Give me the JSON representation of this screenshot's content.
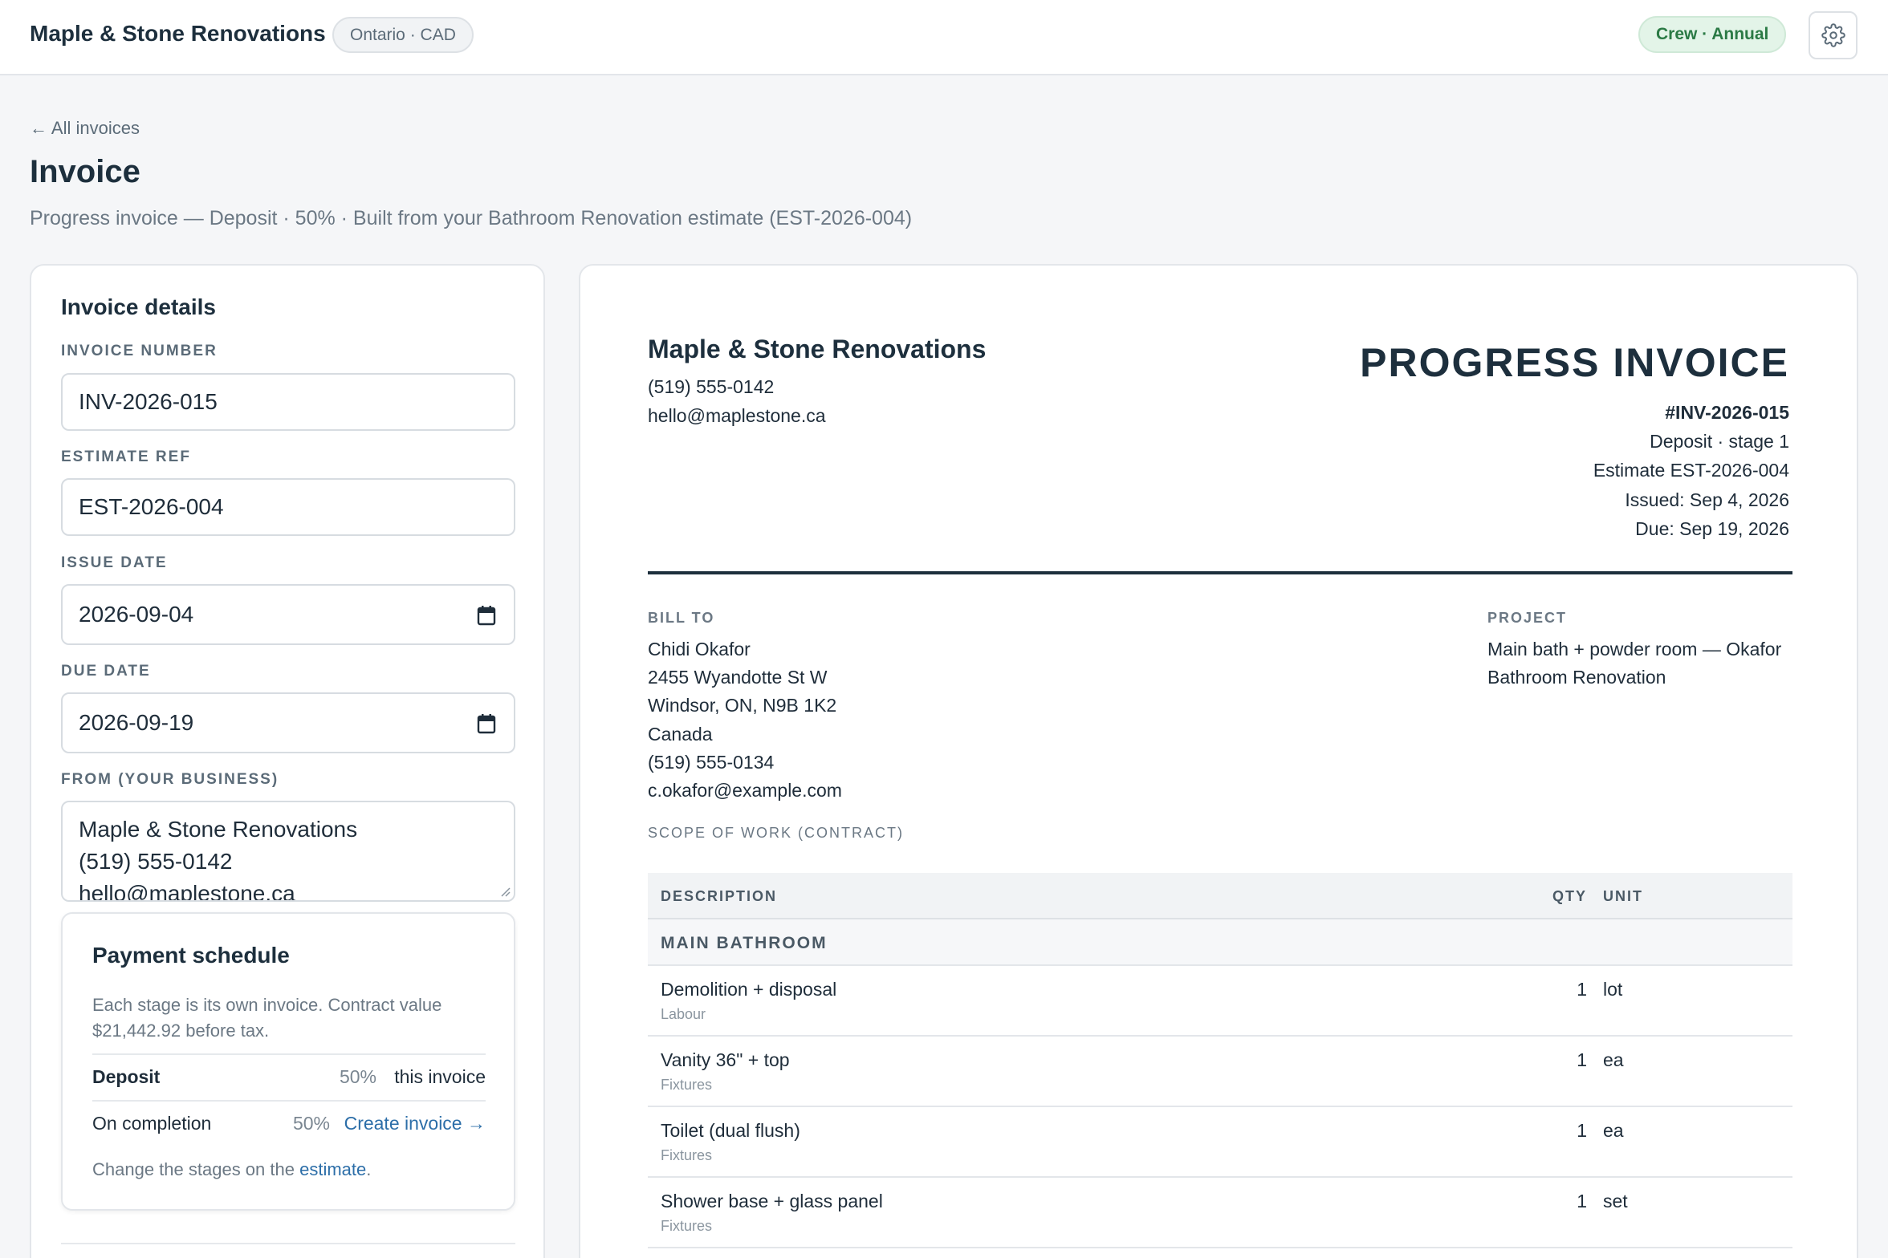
{
  "topbar": {
    "brand": "Maple & Stone Renovations",
    "region": "Ontario · CAD",
    "plan": "Crew · Annual",
    "settings_icon": "gear-icon"
  },
  "header": {
    "back_link": "← All invoices",
    "title": "Invoice",
    "subtitle": "Progress invoice — Deposit · 50% · Built from your Bathroom Renovation estimate (EST-2026-004)"
  },
  "details": {
    "title": "Invoice details",
    "invoice_number_label": "INVOICE NUMBER",
    "invoice_number": "INV-2026-015",
    "estimate_ref_label": "ESTIMATE REF",
    "estimate_ref": "EST-2026-004",
    "issue_date_label": "ISSUE DATE",
    "issue_date": "2026-09-04",
    "due_date_label": "DUE DATE",
    "due_date": "2026-09-19",
    "from_label": "FROM (YOUR BUSINESS)",
    "from_lines": [
      "Maple & Stone Renovations",
      "(519) 555-0142",
      "hello@maplestone.ca"
    ]
  },
  "payment_schedule": {
    "title": "Payment schedule",
    "description": "Each stage is its own invoice. Contract value $21,442.92 before tax.",
    "stages": [
      {
        "name": "Deposit",
        "percent": "50%",
        "action": "this invoice"
      },
      {
        "name": "On completion",
        "percent": "50%",
        "action": "Create invoice →"
      }
    ],
    "footer_text": "Change the stages on the ",
    "footer_link": "estimate",
    "footer_end": "."
  },
  "document": {
    "business_name": "Maple & Stone Renovations",
    "business_phone": "(519) 555-0142",
    "business_email": "hello@maplestone.ca",
    "type": "PROGRESS INVOICE",
    "number": "#INV-2026-015",
    "stage": "Deposit · stage 1",
    "estimate": "Estimate EST-2026-004",
    "issued": "Issued: Sep 4, 2026",
    "due": "Due: Sep 19, 2026",
    "bill_to_label": "BILL TO",
    "bill_to_lines": [
      "Chidi Okafor",
      "2455 Wyandotte St W",
      "Windsor, ON, N9B 1K2",
      "Canada",
      "(519) 555-0134",
      "c.okafor@example.com"
    ],
    "project_label": "PROJECT",
    "project_lines": [
      "Main bath + powder room — Okafor",
      "Bathroom Renovation"
    ],
    "scope_label": "SCOPE OF WORK (CONTRACT)",
    "columns": {
      "description": "DESCRIPTION",
      "qty": "QTY",
      "unit": "UNIT"
    },
    "section": "MAIN BATHROOM",
    "items": [
      {
        "description": "Demolition + disposal",
        "category": "Labour",
        "qty": "1",
        "unit": "lot"
      },
      {
        "description": "Vanity 36\" + top",
        "category": "Fixtures",
        "qty": "1",
        "unit": "ea"
      },
      {
        "description": "Toilet (dual flush)",
        "category": "Fixtures",
        "qty": "1",
        "unit": "ea"
      },
      {
        "description": "Shower base + glass panel",
        "category": "Fixtures",
        "qty": "1",
        "unit": "set"
      }
    ]
  }
}
